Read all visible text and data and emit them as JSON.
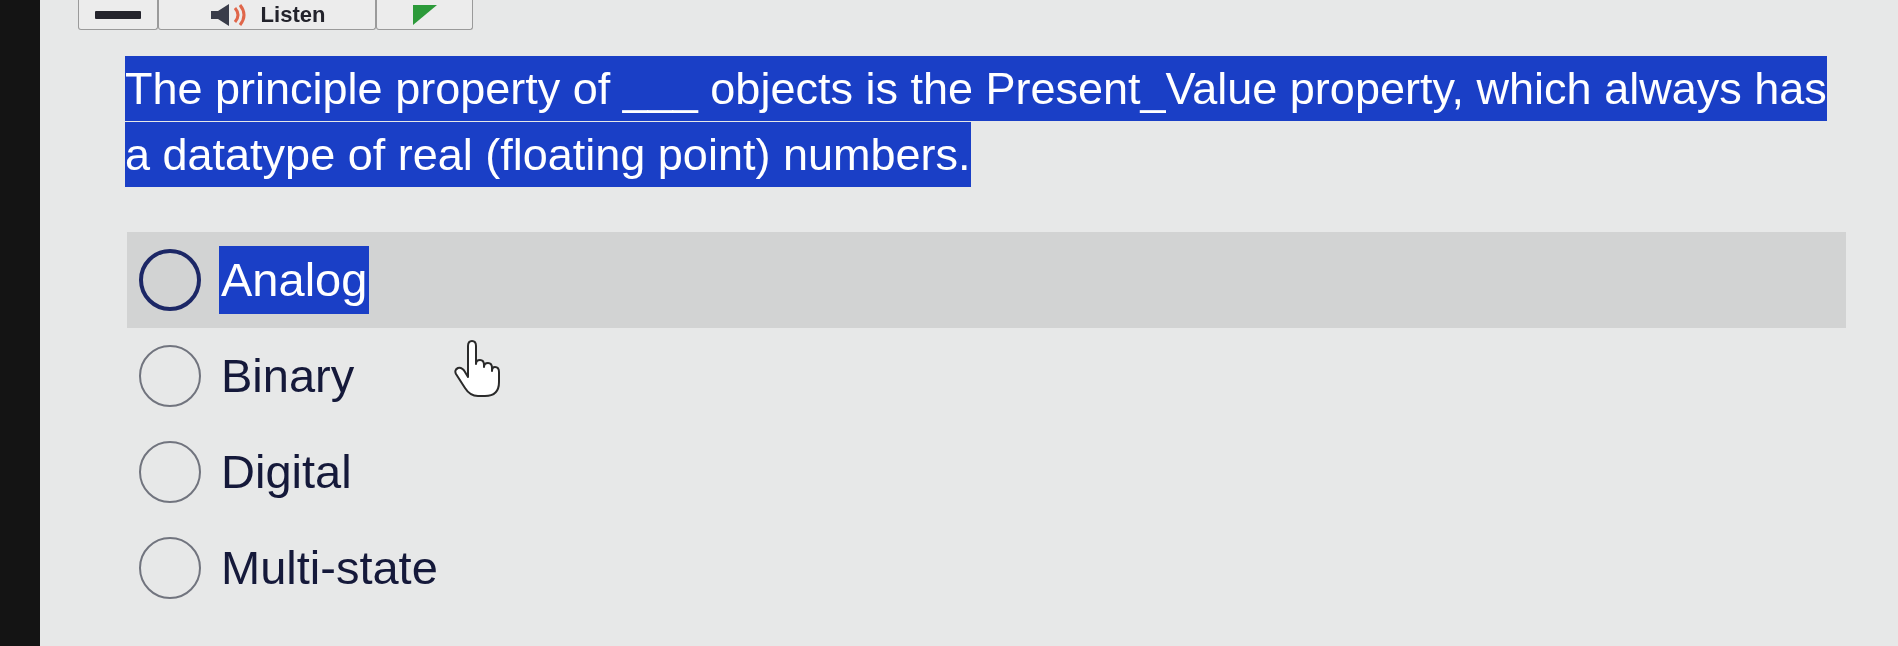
{
  "toolbar": {
    "buttons": [
      {
        "kind": "bar"
      },
      {
        "kind": "listen",
        "label": "Listen"
      },
      {
        "kind": "play"
      }
    ]
  },
  "question": {
    "text": "The principle property of ___ objects is the Present_Value property, which always has a datatype of real (floating point) numbers.",
    "highlighted": true
  },
  "options": [
    {
      "label": "Analog",
      "selected": false,
      "hovered": true,
      "focused": true,
      "highlighted": true
    },
    {
      "label": "Binary",
      "selected": false,
      "hovered": false,
      "focused": false,
      "highlighted": false
    },
    {
      "label": "Digital",
      "selected": false,
      "hovered": false,
      "focused": false,
      "highlighted": false
    },
    {
      "label": "Multi-state",
      "selected": false,
      "hovered": false,
      "focused": false,
      "highlighted": false
    }
  ]
}
